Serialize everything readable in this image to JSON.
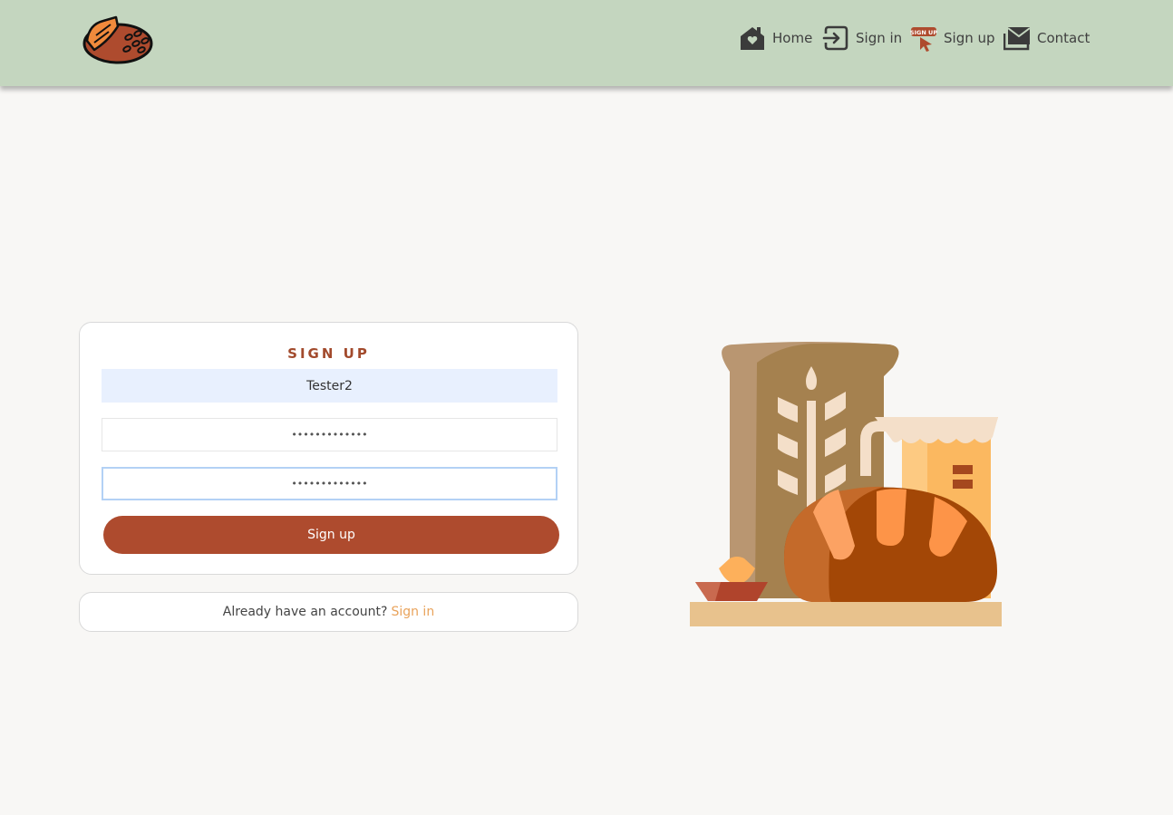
{
  "header": {
    "logo": "bread-logo",
    "nav": [
      {
        "label": "Home",
        "icon": "home-heart-icon"
      },
      {
        "label": "Sign in",
        "icon": "sign-in-icon"
      },
      {
        "label": "Sign up",
        "icon": "sign-up-badge-icon",
        "badge_text": "SIGN UP"
      },
      {
        "label": "Contact",
        "icon": "mail-icon"
      }
    ]
  },
  "signup": {
    "title": "SIGN UP",
    "username": "Tester2",
    "password": "•••••••••••••",
    "confirm_password": "•••••••••••••",
    "submit_label": "Sign up"
  },
  "switch": {
    "prompt": "Already have an account?",
    "link_label": "Sign in"
  },
  "illustration": "bakery-illustration",
  "colors": {
    "header_bg": "#c4d6bf",
    "page_bg": "#f8f7f5",
    "accent": "#ae4b2e",
    "link": "#e9a35b",
    "autofill_bg": "#e8f0fe"
  }
}
